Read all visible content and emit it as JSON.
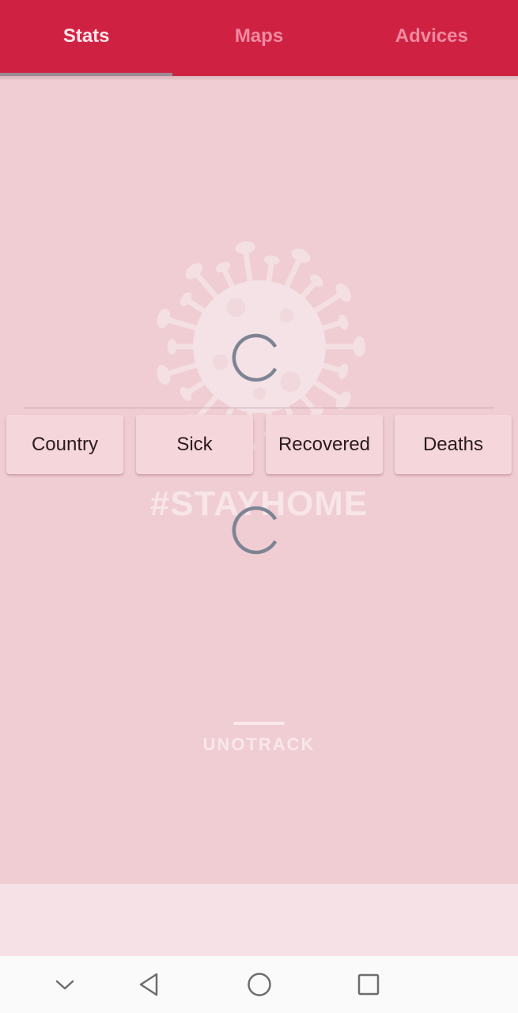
{
  "tabs": [
    {
      "label": "Stats",
      "active": true
    },
    {
      "label": "Maps",
      "active": false
    },
    {
      "label": "Advices",
      "active": false
    }
  ],
  "background": {
    "hashtag": "#STAYHOME",
    "brand": "UNOTRACK"
  },
  "table_header": {
    "columns": [
      "Country",
      "Sick",
      "Recovered",
      "Deaths"
    ]
  },
  "navbar": {
    "keys": [
      "chevron-down-icon",
      "back-icon",
      "home-icon",
      "recents-icon"
    ]
  },
  "colors": {
    "tabbar": "#cf2243",
    "background": "#efcdd3",
    "spinner": "#7e8493"
  }
}
